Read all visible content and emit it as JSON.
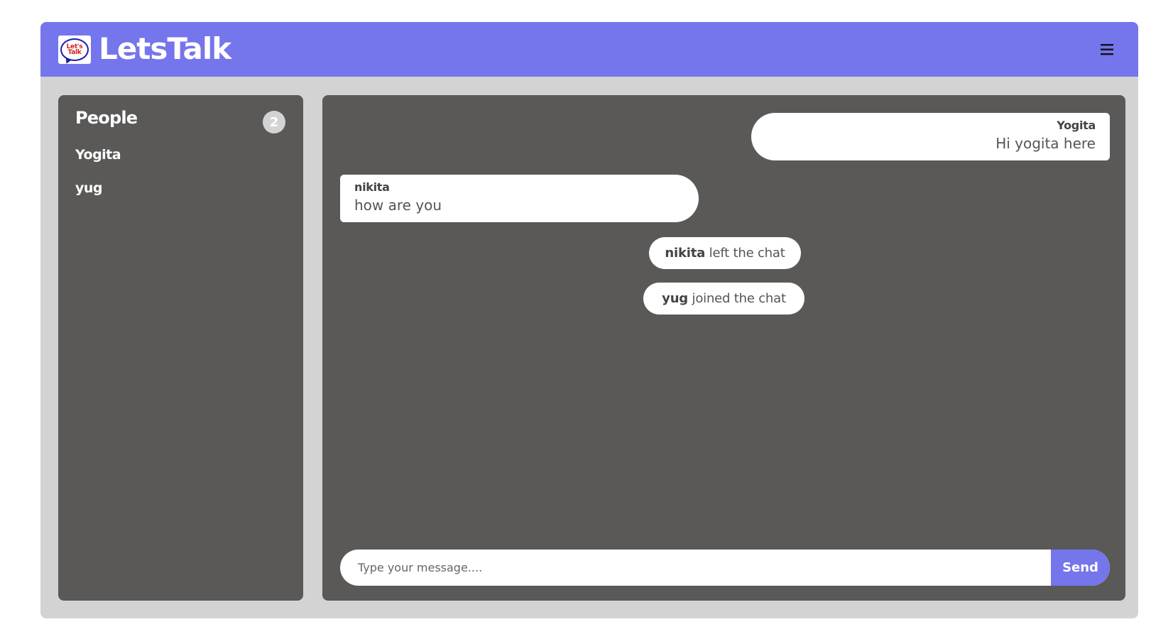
{
  "header": {
    "brand": "LetsTalk",
    "logo_text_line1": "Let's",
    "logo_text_line2": "Talk",
    "menu_icon": "hamburger-menu-icon"
  },
  "people": {
    "title": "People",
    "count": "2",
    "members": [
      "Yogita",
      "yug"
    ]
  },
  "chat": {
    "messages": [
      {
        "sender": "Yogita",
        "text": "Hi yogita here"
      },
      {
        "sender": "nikita",
        "text": "how are you"
      }
    ],
    "notifications": [
      {
        "name": "nikita",
        "action": "left the chat"
      },
      {
        "name": "yug",
        "action": "joined the chat"
      }
    ]
  },
  "composer": {
    "placeholder": "Type your message....",
    "value": "",
    "send_label": "Send"
  },
  "colors": {
    "accent": "#7575ec",
    "panel": "#5a5958",
    "background": "#d3d3d3"
  }
}
